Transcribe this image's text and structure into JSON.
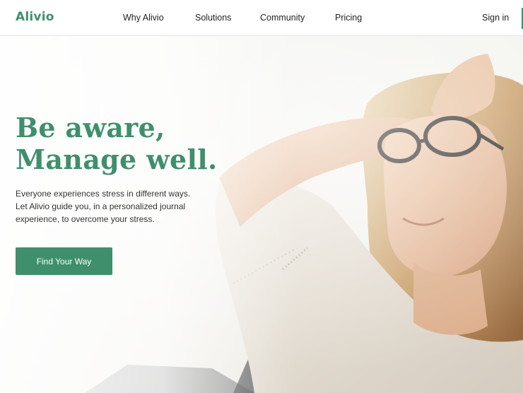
{
  "header": {
    "logo": "Alivio",
    "nav": [
      {
        "label": "Why Alivio"
      },
      {
        "label": "Solutions"
      },
      {
        "label": "Community"
      },
      {
        "label": "Pricing"
      }
    ],
    "sign_in": "Sign in"
  },
  "hero": {
    "headline_line1": "Be aware,",
    "headline_line2": "Manage well.",
    "subtext_line1": "Everyone experiences stress in different ways.",
    "subtext_line2": "Let Alivio guide you, in a personalized journal",
    "subtext_line3": "experience, to overcome your stress.",
    "cta_label": "Find Your Way",
    "photo_subject": "woman-relaxing-photo"
  },
  "colors": {
    "brand": "#3f8f6d",
    "text": "#222222",
    "background": "#ffffff"
  }
}
